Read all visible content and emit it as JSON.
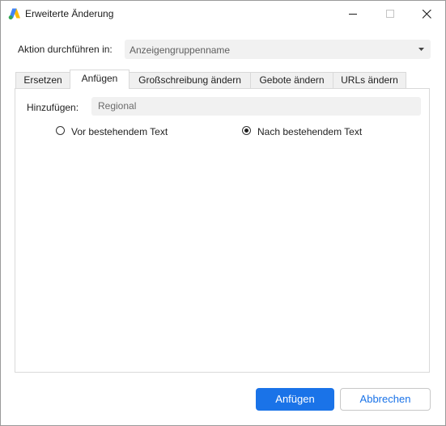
{
  "window": {
    "title": "Erweiterte Änderung",
    "logo_icon": "google-ads-logo-icon",
    "controls": [
      "minimize-icon",
      "maximize-icon",
      "close-icon"
    ]
  },
  "action": {
    "label": "Aktion durchführen in:",
    "selected": "Anzeigengruppenname",
    "dropdown_icon": "caret-down-icon"
  },
  "tabs": [
    {
      "label": "Ersetzen",
      "active": false
    },
    {
      "label": "Anfügen",
      "active": true
    },
    {
      "label": "Großschreibung ändern",
      "active": false
    },
    {
      "label": "Gebote ändern",
      "active": false
    },
    {
      "label": "URLs ändern",
      "active": false
    }
  ],
  "append": {
    "label": "Hinzufügen:",
    "value": "Regional",
    "options": [
      {
        "label": "Vor bestehendem Text",
        "checked": false
      },
      {
        "label": "Nach bestehendem Text",
        "checked": true
      }
    ]
  },
  "buttons": {
    "primary": "Anfügen",
    "secondary": "Abbrechen"
  },
  "colors": {
    "accent": "#1a73e8",
    "field_bg": "#f1f1f1",
    "logo_blue": "#4285f4",
    "logo_yellow": "#fbbc04",
    "logo_green": "#34a853"
  }
}
